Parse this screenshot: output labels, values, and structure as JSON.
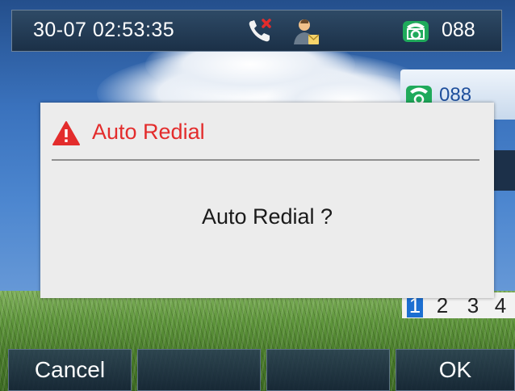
{
  "status_bar": {
    "datetime": "30-07 02:53:35",
    "missed_call_icon": "missed-call-icon",
    "contact_icon": "contact-icon",
    "line_icon": "phone-line-icon",
    "account": "088"
  },
  "line_key": {
    "icon": "phone-line-icon",
    "label": "088"
  },
  "page_indicator": {
    "pages": [
      "1",
      "2",
      "3",
      "4"
    ],
    "active": "1"
  },
  "dialog": {
    "icon": "warning-icon",
    "title": "Auto Redial",
    "message": "Auto Redial ?"
  },
  "softkeys": [
    "Cancel",
    "",
    "",
    "OK"
  ],
  "colors": {
    "dialog_title": "#e32c2c",
    "accent": "#1c6fd1",
    "line_icon": "#1faa5b"
  }
}
